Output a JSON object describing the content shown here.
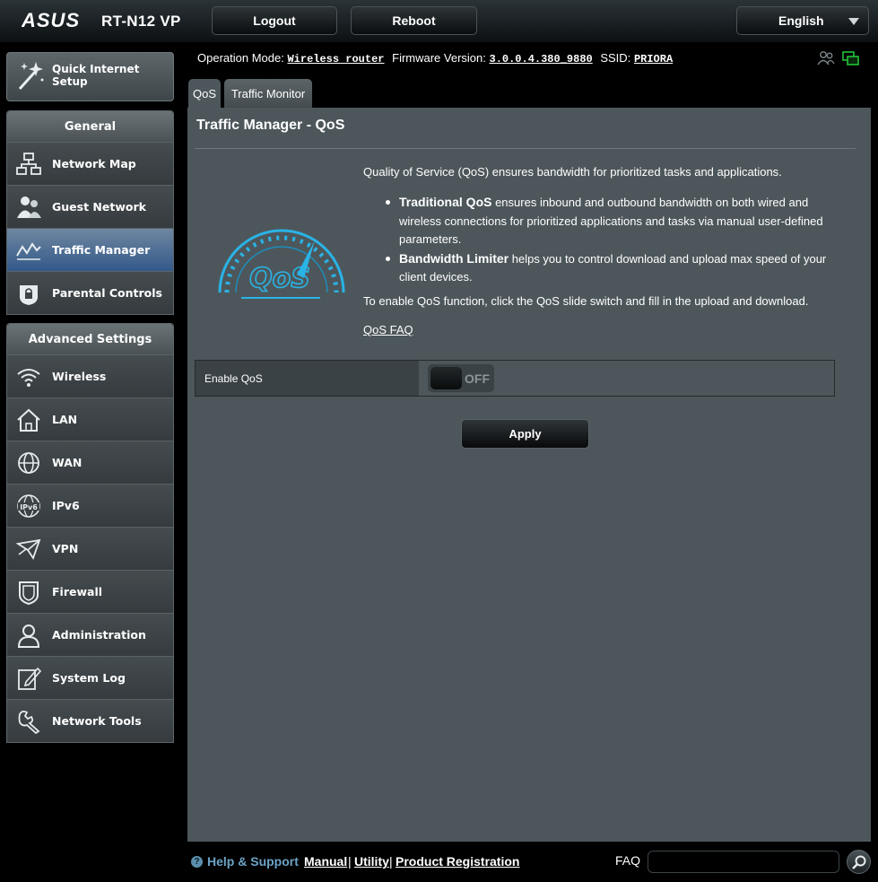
{
  "header": {
    "brand": "ASUS",
    "model": "RT-N12 VP",
    "logout_label": "Logout",
    "reboot_label": "Reboot",
    "language": "English"
  },
  "status": {
    "operation_mode_label": "Operation Mode:",
    "operation_mode": "Wireless router",
    "firmware_label": "Firmware Version:",
    "firmware": "3.0.0.4.380_9880",
    "ssid_label": "SSID:",
    "ssid": "PRIORA"
  },
  "sidebar": {
    "quick_setup_label": "Quick Internet Setup",
    "general_header": "General",
    "general_items": [
      {
        "label": "Network Map",
        "icon": "network-map-icon"
      },
      {
        "label": "Guest Network",
        "icon": "guest-network-icon"
      },
      {
        "label": "Traffic Manager",
        "icon": "traffic-manager-icon",
        "active": true
      },
      {
        "label": "Parental Controls",
        "icon": "parental-controls-icon"
      }
    ],
    "advanced_header": "Advanced Settings",
    "advanced_items": [
      {
        "label": "Wireless",
        "icon": "wireless-icon"
      },
      {
        "label": "LAN",
        "icon": "lan-icon"
      },
      {
        "label": "WAN",
        "icon": "wan-icon"
      },
      {
        "label": "IPv6",
        "icon": "ipv6-icon"
      },
      {
        "label": "VPN",
        "icon": "vpn-icon"
      },
      {
        "label": "Firewall",
        "icon": "firewall-icon"
      },
      {
        "label": "Administration",
        "icon": "administration-icon"
      },
      {
        "label": "System Log",
        "icon": "system-log-icon"
      },
      {
        "label": "Network Tools",
        "icon": "network-tools-icon"
      }
    ]
  },
  "tabs": [
    "QoS",
    "Traffic Monitor"
  ],
  "main": {
    "title": "Traffic Manager - QoS",
    "graphic_text": "QoS",
    "intro": "Quality of Service (QoS) ensures bandwidth for prioritized tasks and applications.",
    "bullets": [
      {
        "term": "Traditional QoS",
        "text": " ensures inbound and outbound bandwidth on both wired and wireless connections for prioritized applications and tasks via manual user-defined parameters."
      },
      {
        "term": "Bandwidth Limiter",
        "text": " helps you to control download and upload max speed of your client devices."
      }
    ],
    "enable_note": "To enable QoS function, click the QoS slide switch and fill in the upload and download.",
    "faq_link": "QoS FAQ",
    "enable_qos_label": "Enable QoS",
    "toggle_state": "OFF",
    "apply_label": "Apply"
  },
  "footer": {
    "help_label": "Help & Support",
    "manual": "Manual",
    "utility": "Utility",
    "product_registration": "Product Registration",
    "separator": "|",
    "faq_label": "FAQ",
    "search_value": ""
  }
}
